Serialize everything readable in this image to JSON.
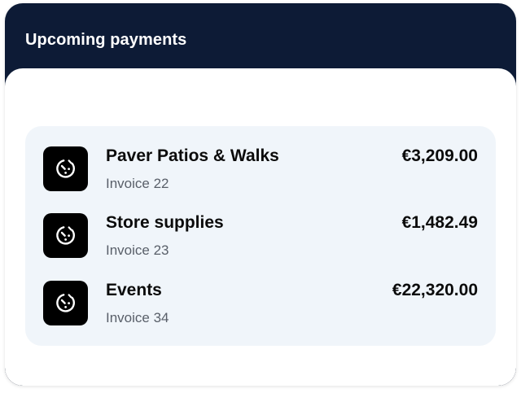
{
  "header": {
    "title": "Upcoming payments"
  },
  "payments": [
    {
      "name": "Paver Patios & Walks",
      "invoice": "Invoice 22",
      "amount": "€3,209.00",
      "icon": "clock-icon"
    },
    {
      "name": "Store supplies",
      "invoice": "Invoice 23",
      "amount": "€1,482.49",
      "icon": "clock-icon"
    },
    {
      "name": "Events",
      "invoice": "Invoice 34",
      "amount": "€22,320.00",
      "icon": "clock-icon"
    }
  ],
  "colors": {
    "header_bg": "#0d1b36",
    "list_bg": "#f0f5fa",
    "icon_bg": "#000000",
    "text_primary": "#0b0b0b",
    "text_secondary": "#595f69"
  }
}
